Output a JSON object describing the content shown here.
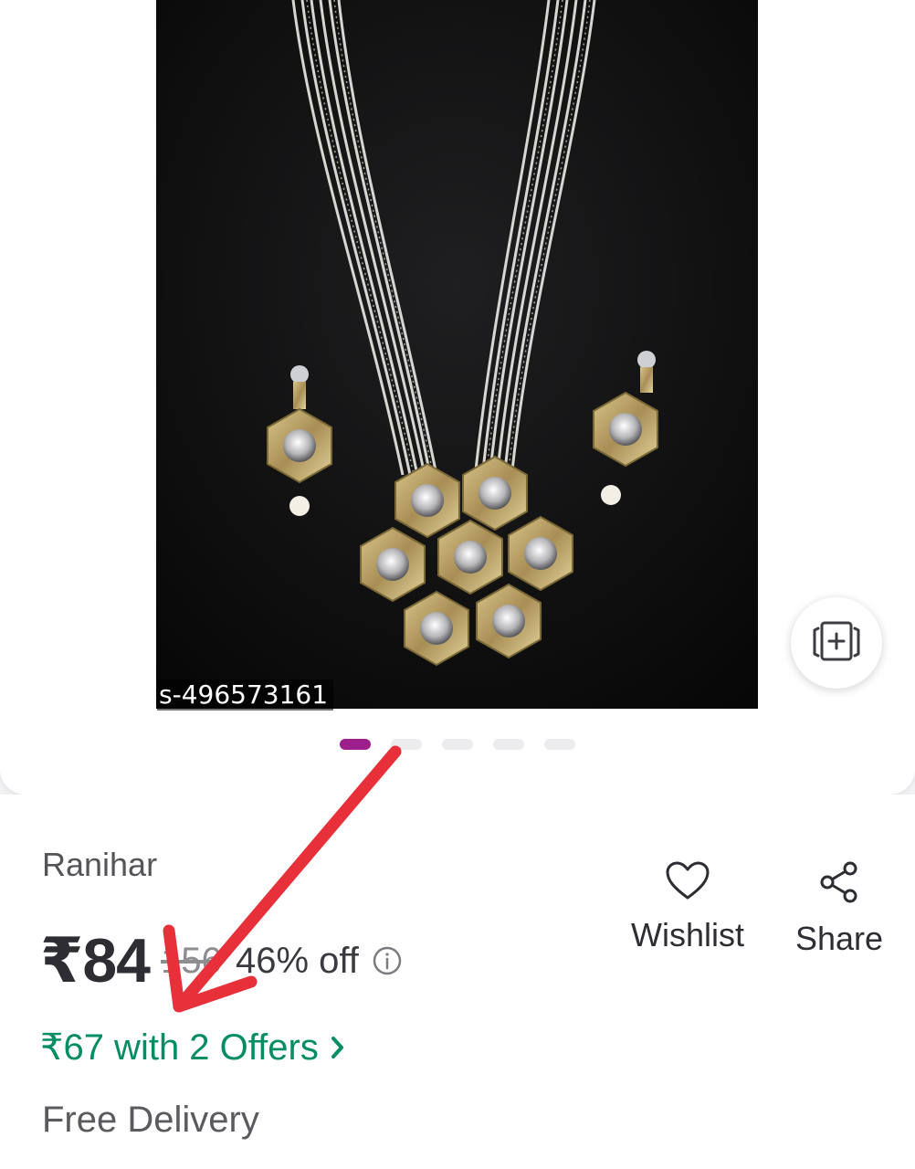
{
  "image": {
    "product_id": "s-496573161",
    "carousel_total": 5,
    "carousel_active_index": 0,
    "active_dot_color": "#9c1f8c"
  },
  "product": {
    "brand": "Ranihar",
    "price": "₹84",
    "mrp_visible": "156",
    "discount": "46% off",
    "offers_text": "₹67 with 2 Offers",
    "delivery": "Free Delivery"
  },
  "actions": {
    "wishlist_label": "Wishlist",
    "share_label": "Share"
  },
  "icons": {
    "compare": "add-to-compare-icon",
    "info": "info-icon",
    "wishlist": "heart-icon",
    "share": "share-icon",
    "offers": "chevron-right-icon"
  },
  "colors": {
    "offers_green": "#038d63",
    "annotation_red": "#e8303a"
  }
}
